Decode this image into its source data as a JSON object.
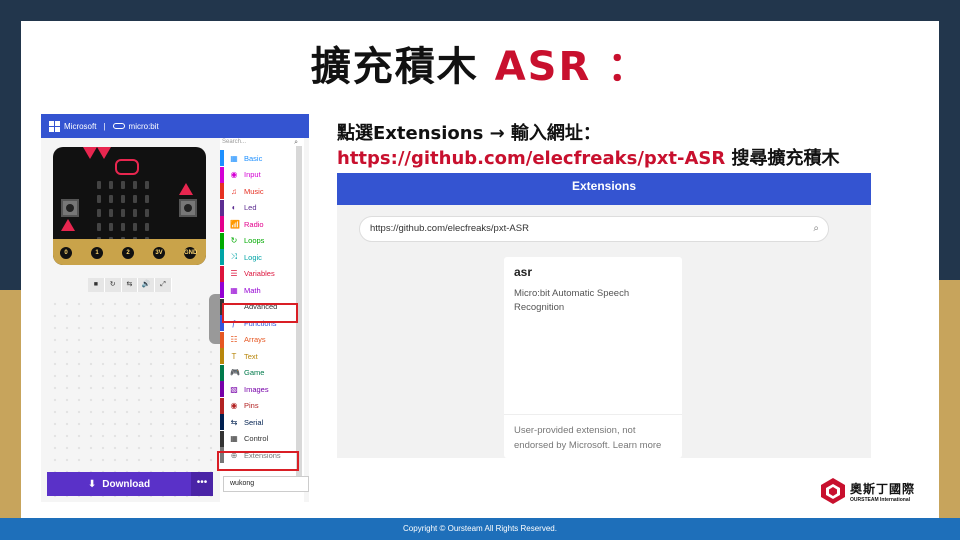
{
  "title": {
    "main": "擴充積木",
    "accent": "ASR ："
  },
  "editor": {
    "header_ms": "Microsoft",
    "header_sep": "|",
    "header_mb": "micro:bit",
    "search_placeholder": "Search...",
    "pins": [
      "0",
      "1",
      "2",
      "3V",
      "GND"
    ],
    "sim_controls": [
      "■",
      "↻",
      "⇆",
      "🔊",
      "⤢"
    ],
    "categories": [
      {
        "label": "Basic",
        "color": "#1e90ff",
        "icon": "▦"
      },
      {
        "label": "Input",
        "color": "#d400d4",
        "icon": "◉"
      },
      {
        "label": "Music",
        "color": "#e63022",
        "icon": "♫"
      },
      {
        "label": "Led",
        "color": "#5c2d91",
        "icon": "◐"
      },
      {
        "label": "Radio",
        "color": "#e3008c",
        "icon": "📶"
      },
      {
        "label": "Loops",
        "color": "#00aa00",
        "icon": "↻"
      },
      {
        "label": "Logic",
        "color": "#00a4a6",
        "icon": "⤨"
      },
      {
        "label": "Variables",
        "color": "#dc143c",
        "icon": "☰"
      },
      {
        "label": "Math",
        "color": "#9400d3",
        "icon": "▦"
      },
      {
        "label": "Advanced",
        "color": "#333333",
        "icon": "⌃"
      },
      {
        "label": "Functions",
        "color": "#3455db",
        "icon": "ƒ"
      },
      {
        "label": "Arrays",
        "color": "#e65722",
        "icon": "☷"
      },
      {
        "label": "Text",
        "color": "#b8860b",
        "icon": "T"
      },
      {
        "label": "Game",
        "color": "#007a4b",
        "icon": "🎮"
      },
      {
        "label": "Images",
        "color": "#7600a8",
        "icon": "▧"
      },
      {
        "label": "Pins",
        "color": "#b22222",
        "icon": "◉"
      },
      {
        "label": "Serial",
        "color": "#002050",
        "icon": "⇆"
      },
      {
        "label": "Control",
        "color": "#333333",
        "icon": "▦"
      },
      {
        "label": "Extensions",
        "color": "#777777",
        "icon": "⊕"
      }
    ],
    "download_label": "Download",
    "more_label": "•••",
    "project_name": "wukong"
  },
  "instructions": {
    "line1": "點選Extensions → 輸入網址：",
    "url": "https://github.com/elecfreaks/pxt-ASR",
    "suffix": "搜尋擴充積木"
  },
  "extensions_dialog": {
    "header": "Extensions",
    "search_value": "https://github.com/elecfreaks/pxt-ASR",
    "card": {
      "title": "asr",
      "description": "Micro:bit Automatic Speech Recognition",
      "footer": "User-provided extension, not endorsed by Microsoft.",
      "learn_more": "Learn more"
    }
  },
  "logo": {
    "cn": "奧斯丁國際",
    "en": "OURSTEAM International"
  },
  "footer": "Copyright © Oursteam All Rights Reserved."
}
